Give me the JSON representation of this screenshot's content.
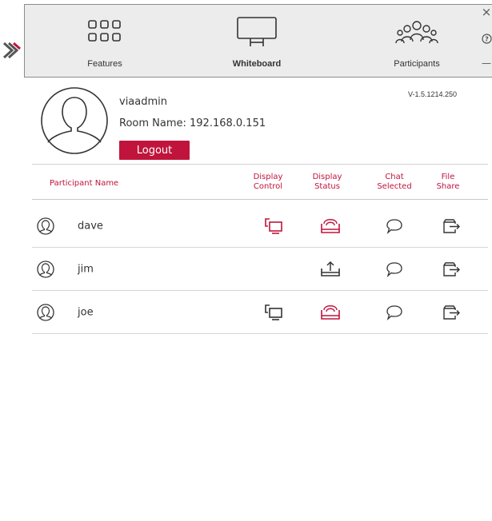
{
  "app": {
    "brand_logo": "via-logo",
    "accent_color": "#c0143c"
  },
  "toolbar": {
    "features_label": "Features",
    "whiteboard_label": "Whiteboard",
    "participants_label": "Participants",
    "close_glyph": "×",
    "help_glyph": "?",
    "minimize_glyph": "—"
  },
  "profile": {
    "username": "viaadmin",
    "room_name": "Room Name: 192.168.0.151",
    "logout_label": "Logout",
    "version": "V-1.5.1214.250"
  },
  "table": {
    "headers": {
      "participant_name": "Participant Name",
      "display_control": [
        "Display",
        "Control"
      ],
      "display_status": [
        "Display",
        "Status"
      ],
      "chat_selected": [
        "Chat",
        "Selected"
      ],
      "file_share": [
        "File",
        "Share"
      ]
    },
    "rows": [
      {
        "name": "dave",
        "display_control": "display-control-icon-active",
        "display_status": "display-status-streaming-icon",
        "chat": "chat-bubble-icon",
        "file_share": "file-share-icon"
      },
      {
        "name": "jim",
        "display_control": "",
        "display_status": "display-status-upload-icon",
        "chat": "chat-bubble-icon",
        "file_share": "file-share-icon"
      },
      {
        "name": "joe",
        "display_control": "display-control-icon",
        "display_status": "display-status-streaming-icon",
        "chat": "chat-bubble-icon",
        "file_share": "file-share-icon"
      }
    ]
  }
}
